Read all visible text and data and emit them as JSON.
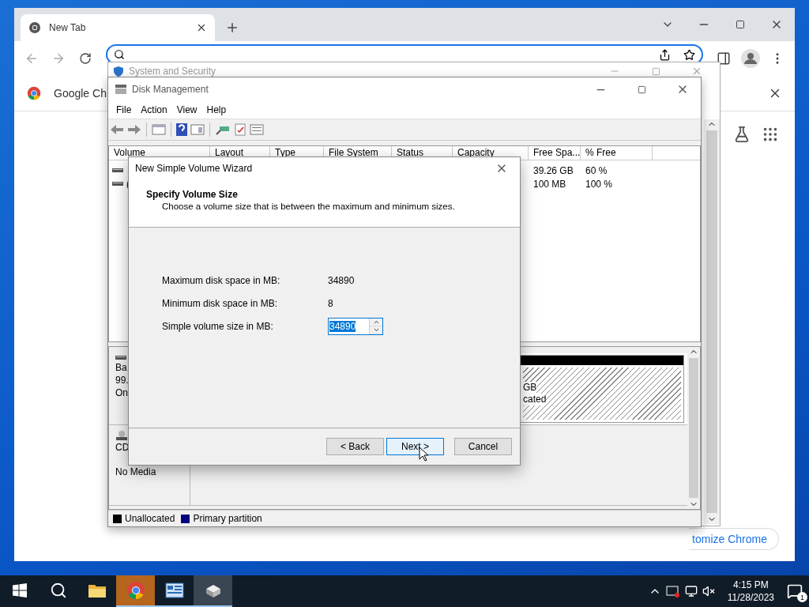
{
  "browser": {
    "tabs": [
      {
        "label": "New Tab",
        "selected": true
      }
    ],
    "infobar": {
      "text": "Google Ch"
    },
    "customize_button": "tomize Chrome"
  },
  "control_panel_window": {
    "title": "System and Security"
  },
  "disk_management": {
    "title": "Disk Management",
    "menu": [
      "File",
      "Action",
      "View",
      "Help"
    ],
    "columns": [
      "Volume",
      "Layout",
      "Type",
      "File System",
      "Status",
      "Capacity",
      "Free Spa...",
      "% Free"
    ],
    "rows": [
      {
        "volume": "",
        "free_space": "39.26 GB",
        "percent_free": "60 %"
      },
      {
        "volume": "(",
        "free_space": "100 MB",
        "percent_free": "100 %"
      }
    ],
    "disks": [
      {
        "kind": "basic",
        "lines": [
          "Ba",
          "99.",
          "On"
        ],
        "partition_lines": [
          "GB",
          "cated"
        ]
      },
      {
        "kind": "cdrom",
        "lines": [
          "CD",
          "No Media"
        ]
      }
    ],
    "legend": [
      {
        "label": "Unallocated",
        "color": "#000000"
      },
      {
        "label": "Primary partition",
        "color": "#000080"
      }
    ]
  },
  "wizard": {
    "title": "New Simple Volume Wizard",
    "heading": "Specify Volume Size",
    "subtitle": "Choose a volume size that is between the maximum and minimum sizes.",
    "fields": [
      {
        "kind": "text",
        "label": "Maximum disk space in MB:",
        "value": "34890"
      },
      {
        "kind": "text",
        "label": "Minimum disk space in MB:",
        "value": "8"
      },
      {
        "kind": "spin",
        "label": "Simple volume size in MB:",
        "value": "34890",
        "selected": true
      }
    ],
    "buttons": [
      {
        "label": "< Back",
        "focused": false
      },
      {
        "label": "Next >",
        "focused": true
      },
      {
        "label": "Cancel",
        "focused": false
      }
    ]
  },
  "taskbar": {
    "apps": [
      {
        "kind": "folder",
        "running": false,
        "active": false
      },
      {
        "kind": "chrome",
        "running": true,
        "active": true
      },
      {
        "kind": "control-panel",
        "running": true,
        "active": false
      },
      {
        "kind": "disk",
        "running": true,
        "active": true
      }
    ],
    "time": "4:15 PM",
    "date": "11/28/2023",
    "notification_count": "1"
  }
}
